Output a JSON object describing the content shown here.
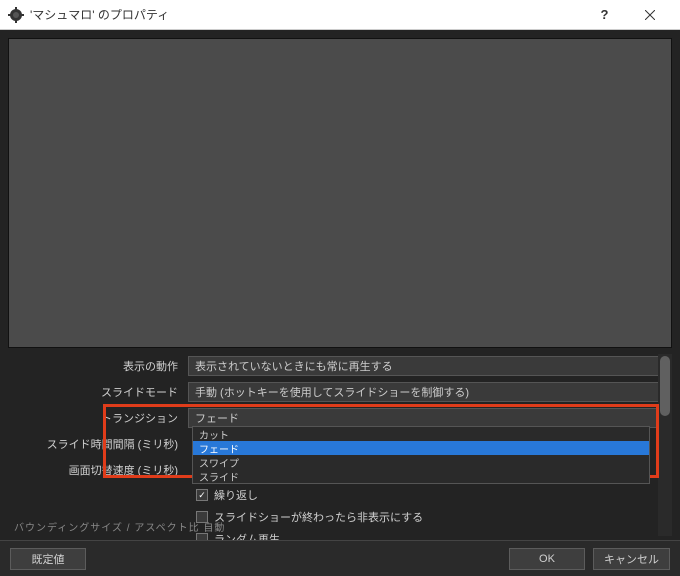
{
  "window": {
    "title": "'マシュマロ' のプロパティ"
  },
  "props": {
    "display_behavior": {
      "label": "表示の動作",
      "value": "表示されていないときにも常に再生する"
    },
    "slide_mode": {
      "label": "スライドモード",
      "value": "手動 (ホットキーを使用してスライドショーを制御する)"
    },
    "transition": {
      "label": "トランジション",
      "value": "フェード"
    },
    "slide_interval": {
      "label": "スライド時間間隔 (ミリ秒)"
    },
    "switch_speed": {
      "label": "画面切替速度 (ミリ秒)"
    },
    "loop": {
      "label": "繰り返し",
      "checked": true
    },
    "hide_after": {
      "label": "スライドショーが終わったら非表示にする",
      "checked": false
    },
    "random": {
      "label": "ランダム再生",
      "checked": false
    },
    "cutoff": "バウンディングサイズ / アスペクト比       自動"
  },
  "dropdown": {
    "options": [
      "カット",
      "フェード",
      "スワイプ",
      "スライド"
    ],
    "selected_index": 1
  },
  "buttons": {
    "defaults": "既定値",
    "ok": "OK",
    "cancel": "キャンセル"
  }
}
